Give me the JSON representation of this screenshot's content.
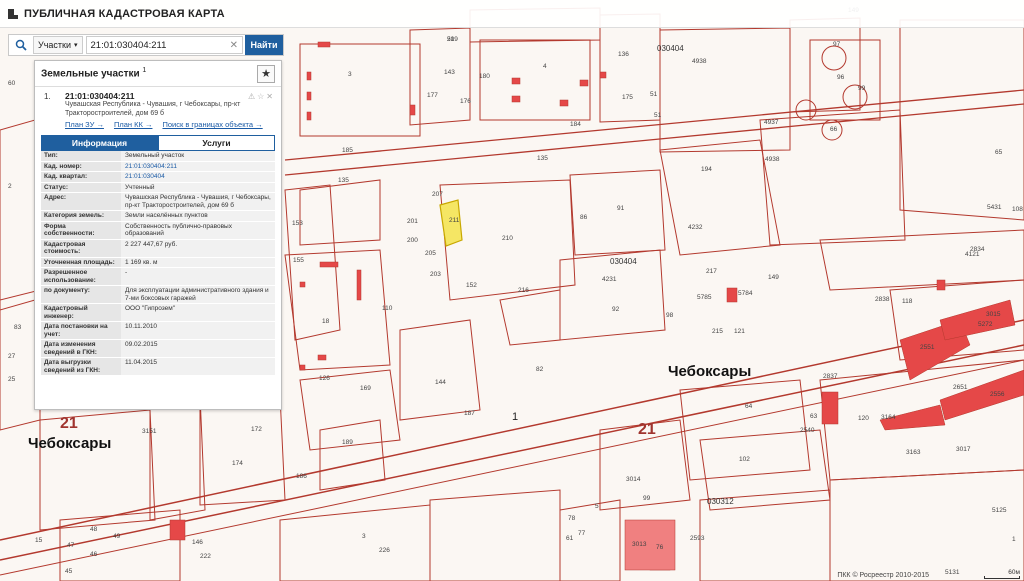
{
  "app": {
    "title": "ПУБЛИЧНАЯ КАДАСТРОВАЯ КАРТА"
  },
  "search": {
    "type": "Участки",
    "value": "21:01:030404:211",
    "button": "Найти"
  },
  "panel": {
    "title": "Земельные участки",
    "count": "1",
    "result": {
      "index": "1.",
      "id": "21:01:030404:211",
      "address": "Чувашская Республика - Чувашия, г Чебоксары, пр-кт Тракторостроителей, дом 69 б",
      "links": [
        "План ЗУ →",
        "План КК →",
        "Поиск в границах объекта →"
      ]
    },
    "tabs": [
      "Информация",
      "Услуги"
    ],
    "info": [
      {
        "k": "Тип:",
        "v": "Земельный участок"
      },
      {
        "k": "Кад. номер:",
        "v": "21:01:030404:211",
        "link": true
      },
      {
        "k": "Кад. квартал:",
        "v": "21:01:030404",
        "link": true
      },
      {
        "k": "Статус:",
        "v": "Учтенный"
      },
      {
        "k": "Адрес:",
        "v": "Чувашская Республика - Чувашия, г Чебоксары, пр-кт Тракторостроителей, дом 69 б"
      },
      {
        "k": "Категория земель:",
        "v": "Земли населённых пунктов"
      },
      {
        "k": "Форма собственности:",
        "v": "Собственность публично-правовых образований"
      },
      {
        "k": "Кадастровая стоимость:",
        "v": "2 227 447,67 руб."
      },
      {
        "k": "Уточненная площадь:",
        "v": "1 169 кв. м"
      },
      {
        "k": "Разрешенное использование:",
        "v": "-"
      },
      {
        "k": "по документу:",
        "v": "Для эксплуатации административного здания и 7-ми боксовых гаражей"
      },
      {
        "k": "Кадастровый инженер:",
        "v": "ООО \"Гипрозем\""
      },
      {
        "k": "Дата постановки на учет:",
        "v": "10.11.2010"
      },
      {
        "k": "Дата изменения сведений в ГКН:",
        "v": "09.02.2015"
      },
      {
        "k": "Дата выгрузки сведений из ГКН:",
        "v": "11.04.2015"
      }
    ]
  },
  "map": {
    "city_labels": [
      "Чебоксары",
      "Чебоксары"
    ],
    "region_labels": [
      "21",
      "21"
    ],
    "quarter_labels": [
      "030404",
      "030404",
      "030312"
    ],
    "road_label": "1",
    "plot_labels": [
      "209",
      "3",
      "4",
      "143",
      "176",
      "177",
      "180",
      "184",
      "4938",
      "4937",
      "4938",
      "97",
      "96",
      "99",
      "66",
      "135",
      "135",
      "175",
      "51",
      "51",
      "136",
      "185",
      "207",
      "211",
      "210",
      "153",
      "155",
      "200",
      "205",
      "203",
      "201",
      "152",
      "18",
      "110",
      "126",
      "144",
      "187",
      "169",
      "172",
      "174",
      "186",
      "189",
      "82",
      "86",
      "91",
      "194",
      "4232",
      "4231",
      "92",
      "98",
      "216",
      "217",
      "5785",
      "5784",
      "149",
      "215",
      "121",
      "2837",
      "4121",
      "120",
      "3164",
      "118",
      "2651",
      "2556",
      "5272",
      "2551",
      "3015",
      "3017",
      "3163",
      "2838",
      "2834",
      "5431",
      "108",
      "65",
      "64",
      "63",
      "2540",
      "102",
      "99",
      "3014",
      "3013",
      "2593",
      "76",
      "78",
      "77",
      "61",
      "47",
      "46",
      "45",
      "48",
      "49",
      "25",
      "27",
      "83",
      "70",
      "2",
      "60",
      "1",
      "5131",
      "5125",
      "3151",
      "146",
      "222",
      "149",
      "226",
      "3",
      "15",
      "5",
      "51"
    ],
    "colors": {
      "highlight": "#f5e664",
      "boundary": "#b3392e",
      "building": "#e54848",
      "label": "#333333"
    }
  },
  "footer": {
    "attribution": "ПКК © Росреестр 2010-2015",
    "scale": "60м"
  }
}
